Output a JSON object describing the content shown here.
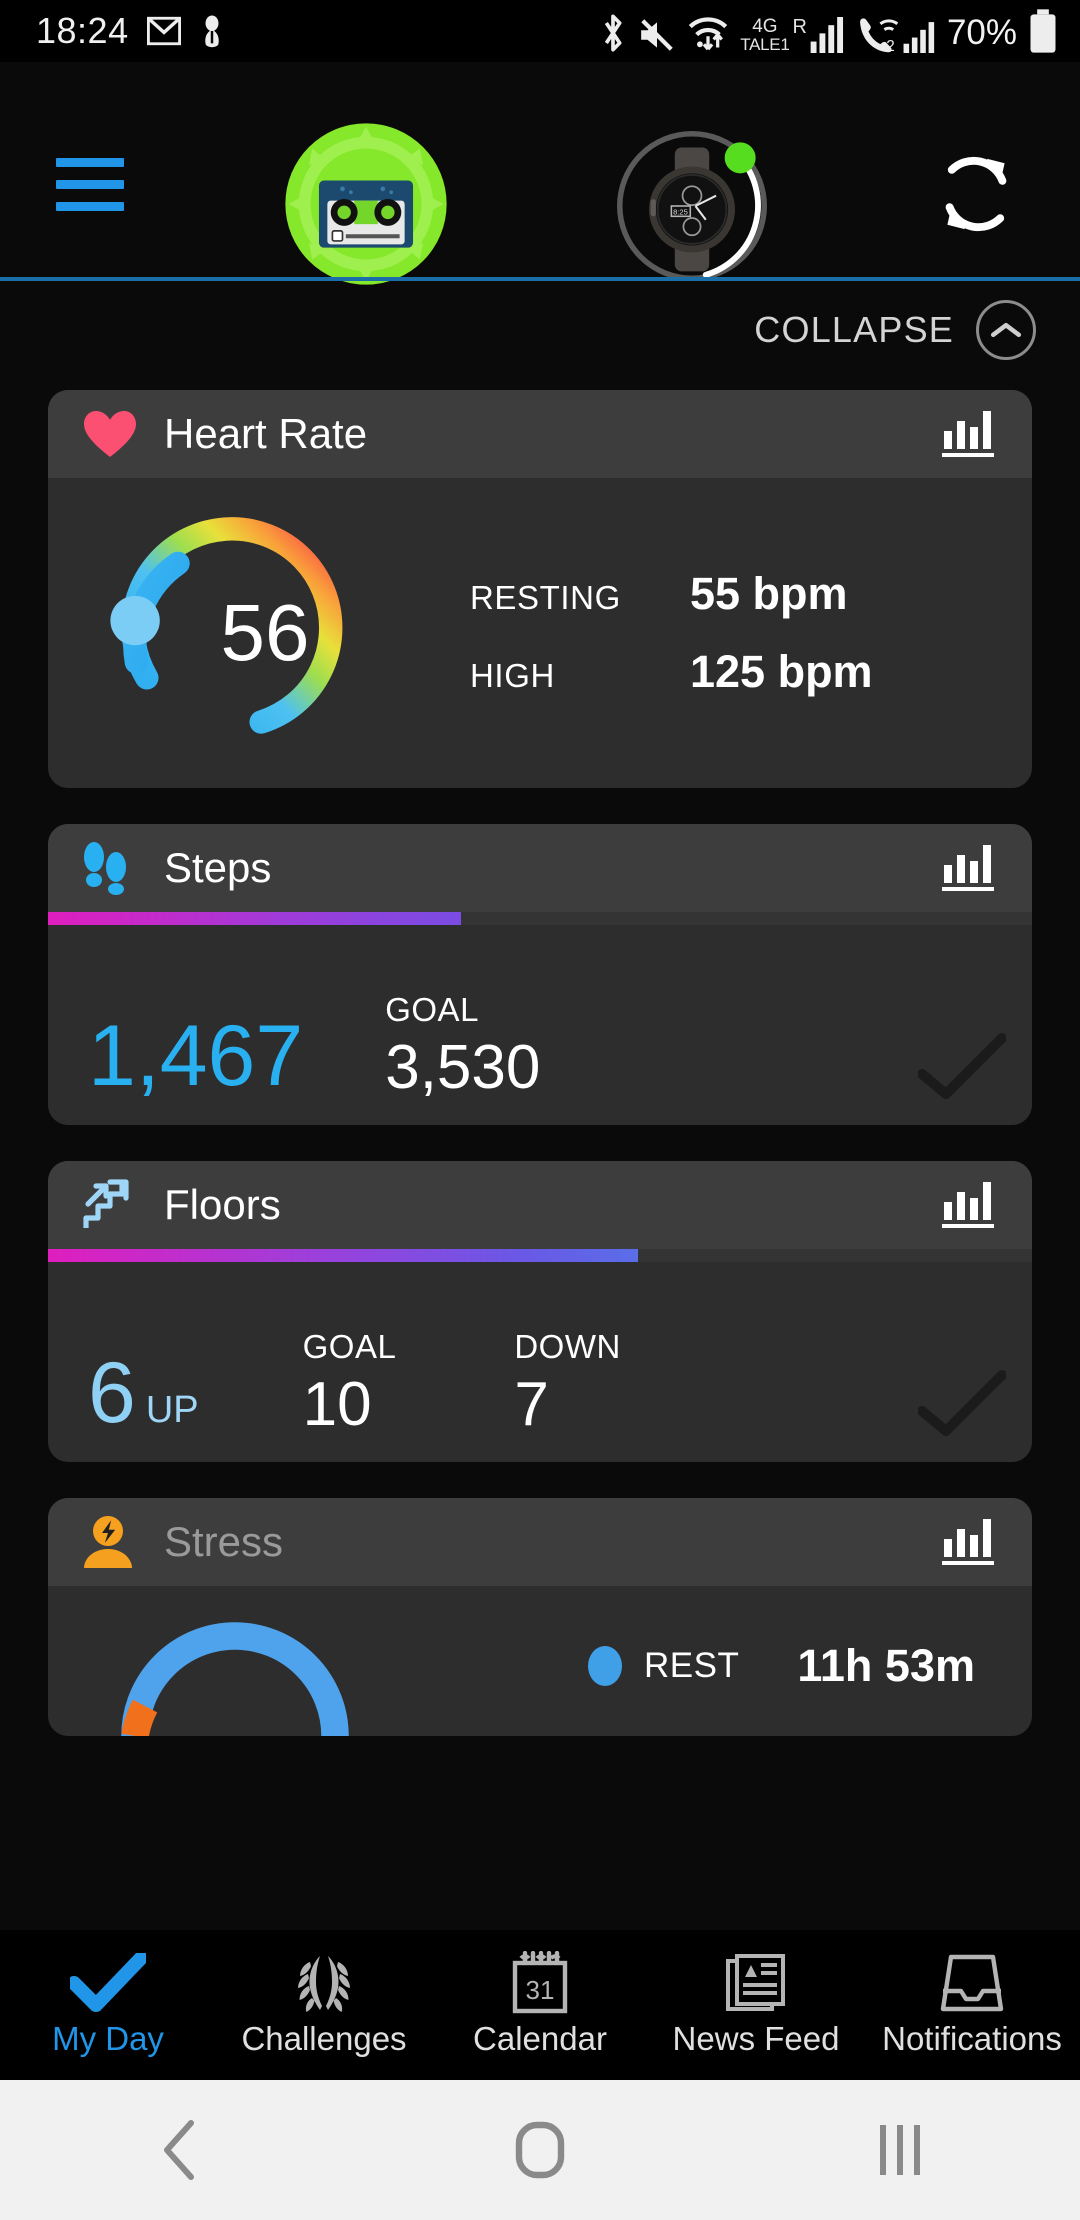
{
  "status_bar": {
    "clock": "18:24",
    "icons_left": [
      "gmail-icon",
      "app-icon"
    ],
    "icons_right": [
      "bluetooth-icon",
      "mute-icon",
      "wifi-icon"
    ],
    "network_label_top": "4G",
    "network_label_bottom": "TALE1",
    "roaming_label": "R",
    "sim2_label": "2",
    "battery_percent": "70%"
  },
  "header": {
    "menu_icon": "hamburger-menu-icon",
    "avatar_icon": "cassette-gear-avatar",
    "device_icon": "watch-device-icon",
    "refresh_icon": "sync-refresh-icon"
  },
  "collapse": {
    "label": "COLLAPSE",
    "icon": "chevron-up-icon"
  },
  "cards": {
    "heart_rate": {
      "title": "Heart Rate",
      "icon": "heart-icon",
      "chart_icon": "bar-chart-icon",
      "current": "56",
      "resting_label": "RESTING",
      "resting_value": "55 bpm",
      "high_label": "HIGH",
      "high_value": "125 bpm"
    },
    "steps": {
      "title": "Steps",
      "icon": "footprints-icon",
      "chart_icon": "bar-chart-icon",
      "value": "1,467",
      "goal_label": "GOAL",
      "goal_value": "3,530",
      "progress_percent": 42
    },
    "floors": {
      "title": "Floors",
      "icon": "stairs-up-icon",
      "chart_icon": "bar-chart-icon",
      "value": "6",
      "value_suffix": "UP",
      "goal_label": "GOAL",
      "goal_value": "10",
      "down_label": "DOWN",
      "down_value": "7",
      "progress_percent": 60
    },
    "stress": {
      "title": "Stress",
      "icon": "stress-person-icon",
      "chart_icon": "bar-chart-icon",
      "legend_label": "REST",
      "legend_value": "11h 53m"
    }
  },
  "bottom_nav": {
    "items": [
      {
        "label": "My Day",
        "icon": "checkmark-icon",
        "active": true
      },
      {
        "label": "Challenges",
        "icon": "laurel-wreath-icon",
        "active": false
      },
      {
        "label": "Calendar",
        "icon": "calendar-31-icon",
        "active": false
      },
      {
        "label": "News Feed",
        "icon": "newspaper-icon",
        "active": false
      },
      {
        "label": "Notifications",
        "icon": "inbox-tray-icon",
        "active": false
      }
    ]
  },
  "system_nav": {
    "back_icon": "back-chevron-icon",
    "home_icon": "home-square-icon",
    "recents_icon": "recents-bars-icon"
  },
  "colors": {
    "accent_blue": "#2196e8",
    "heart_red": "#fb5072",
    "stress_orange": "#f5a01e",
    "progress_start": "#e01ebe",
    "progress_end": "#5a6ee8",
    "card_bg": "#2d2d2d",
    "card_head_bg": "#3d3d3d",
    "divider_blue": "#1a6fa8"
  }
}
